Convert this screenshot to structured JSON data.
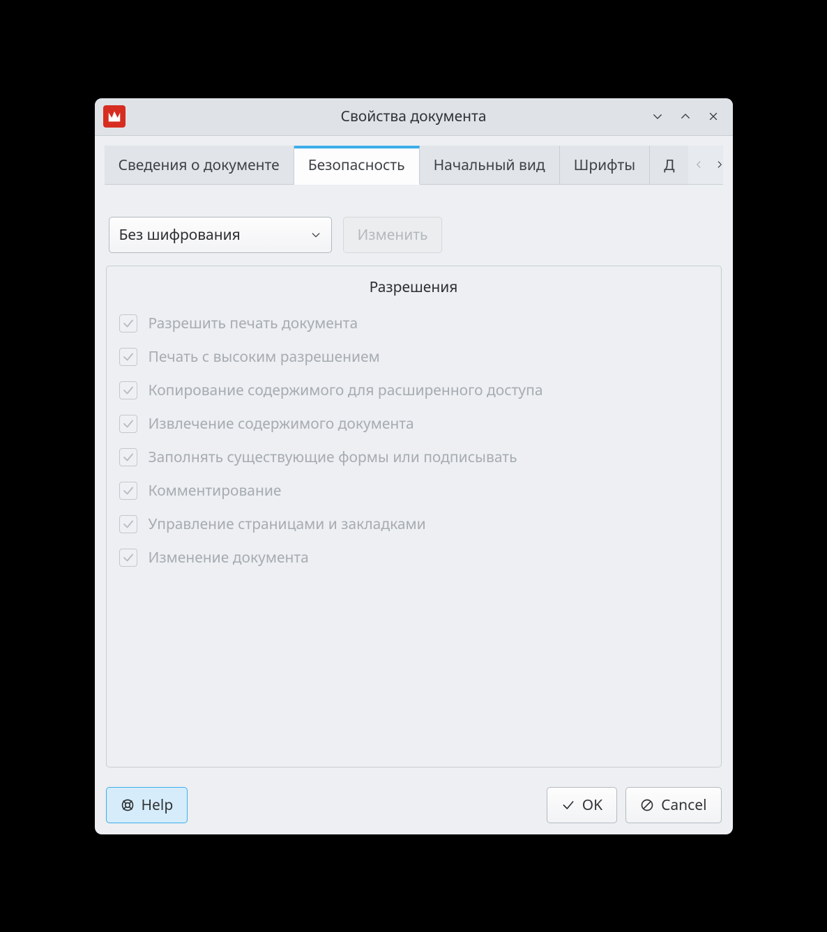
{
  "window": {
    "title": "Свойства документа"
  },
  "tabs": {
    "document_info": "Сведения о документе",
    "security": "Безопасность",
    "initial_view": "Начальный вид",
    "fonts": "Шрифты",
    "more_peek": "Д"
  },
  "security": {
    "encryption_select": "Без шифрования",
    "change_button": "Изменить",
    "permissions_title": "Разрешения",
    "permissions": [
      "Разрешить печать документа",
      "Печать с высоким разрешением",
      "Копирование содержимого для расширенного доступа",
      "Извлечение содержимого документа",
      "Заполнять существующие формы или подписывать",
      "Комментирование",
      "Управление страницами и закладками",
      "Изменение документа"
    ]
  },
  "footer": {
    "help": "Help",
    "ok": "OK",
    "cancel": "Cancel"
  }
}
